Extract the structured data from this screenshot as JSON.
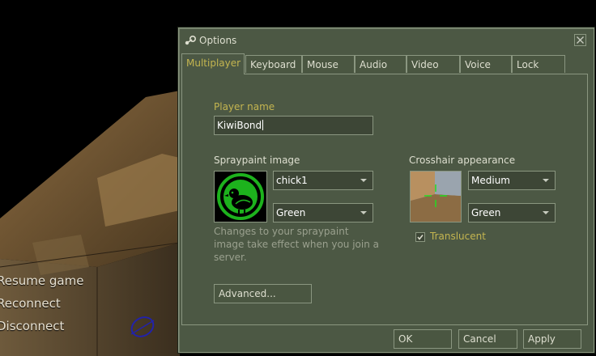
{
  "game_menu": {
    "items": [
      "Resume game",
      "Reconnect",
      "Disconnect"
    ]
  },
  "dialog": {
    "title": "Options",
    "icon": "steam-icon",
    "tabs": [
      "Multiplayer",
      "Keyboard",
      "Mouse",
      "Audio",
      "Video",
      "Voice",
      "Lock"
    ],
    "active_tab": "Multiplayer",
    "player_name_label": "Player name",
    "player_name_value": "KiwiBond",
    "spray_label": "Spraypaint image",
    "spray_image": "chick1",
    "spray_color": "Green",
    "spray_help": [
      "Changes to your spraypaint",
      "image take effect when you join a",
      "server."
    ],
    "advanced_label": "Advanced...",
    "crosshair_label": "Crosshair appearance",
    "crosshair_size": "Medium",
    "crosshair_color": "Green",
    "translucent_label": "Translucent",
    "translucent_checked": true,
    "ok_label": "OK",
    "cancel_label": "Cancel",
    "apply_label": "Apply"
  },
  "colors": {
    "panel_bg": "#4c5844",
    "accent_gold": "#c4b550",
    "border": "#8a9680",
    "spray_green": "#1db21d"
  }
}
